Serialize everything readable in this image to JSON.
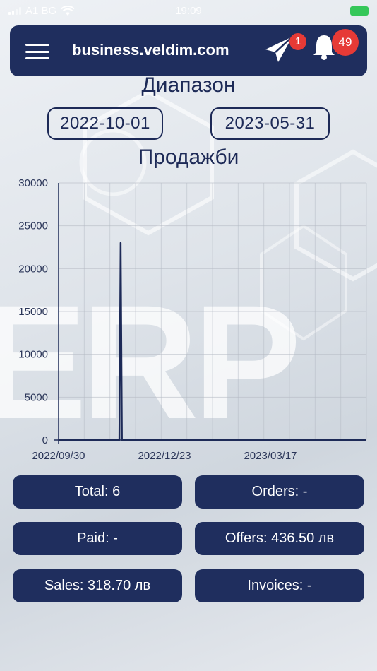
{
  "status_bar": {
    "carrier": "A1 BG",
    "time": "19:09"
  },
  "header": {
    "title": "business.veldim.com",
    "messages_count": "1",
    "notifications_count": "49",
    "accent_color": "#1f2e5e",
    "badge_color": "#e63a36"
  },
  "range": {
    "label": "Диапазон",
    "from": "2022-10-01",
    "to": "2023-05-31"
  },
  "sales": {
    "label": "Продажби"
  },
  "chart_data": {
    "type": "line",
    "title": "",
    "xlabel": "",
    "ylabel": "",
    "x_ticks": [
      "2022/09/30",
      "2022/12/23",
      "2023/03/17"
    ],
    "y_ticks": [
      "0",
      "5000",
      "10000",
      "15000",
      "20000",
      "25000",
      "30000"
    ],
    "xlim": [
      "2022-09-30",
      "2023-05-31"
    ],
    "ylim": [
      0,
      30000
    ],
    "grid": true,
    "series": [
      {
        "color": "#1d2a57",
        "points": [
          {
            "x": "2022-09-30",
            "y": 0
          },
          {
            "x": "2022-11-17",
            "y": 0
          },
          {
            "x": "2022-11-18",
            "y": 23000
          },
          {
            "x": "2022-11-19",
            "y": 0
          },
          {
            "x": "2023-05-31",
            "y": 0
          }
        ]
      }
    ]
  },
  "stats": {
    "total": "Total: 6",
    "orders": "Orders: -",
    "paid": "Paid: -",
    "offers": "Offers: 436.50 лв",
    "sales": "Sales: 318.70 лв",
    "invoices": "Invoices: -"
  }
}
